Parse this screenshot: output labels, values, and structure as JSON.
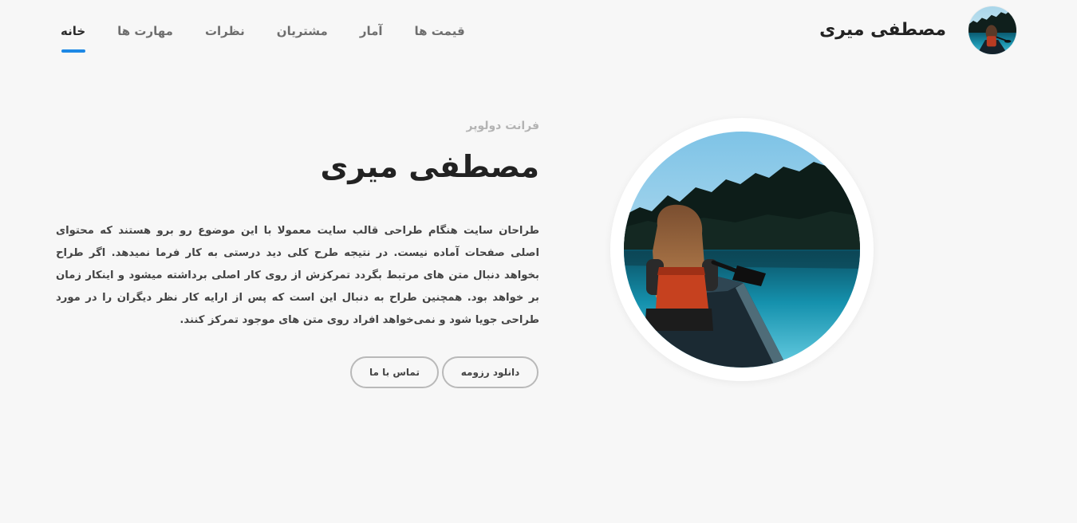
{
  "header": {
    "brand_name": "مصطفی میری",
    "avatar_icon": "person-in-canoe-photo"
  },
  "nav": {
    "items": [
      {
        "label": "خانه",
        "active": true
      },
      {
        "label": "مهارت ها",
        "active": false
      },
      {
        "label": "نظرات",
        "active": false
      },
      {
        "label": "مشتریان",
        "active": false
      },
      {
        "label": "آمار",
        "active": false
      },
      {
        "label": "قیمت ها",
        "active": false
      }
    ]
  },
  "hero": {
    "subtitle": "فرانت دولوپر",
    "title": "مصطفی میری",
    "description": "طراحان سایت هنگام طراحی قالب سایت معمولا با این موضوع رو برو هستند که محتوای اصلی صفحات آماده نیست. در نتیجه طرح کلی دید درستی به کار فرما نمیدهد. اگر طراح بخواهد دنبال متن های مرتبط بگردد تمرکزش از روی کار اصلی برداشته میشود و اینکار زمان بر خواهد بود. همچنین طراح به دنبال این است که پس از ارایه کار نظر دیگران را در مورد طراحی جویا شود و نمی‌خواهد افراد روی متن های موجود تمرکز کنند.",
    "buttons": {
      "resume": "دانلود رزومه",
      "contact": "تماس با ما"
    },
    "image_icon": "person-in-canoe-photo"
  },
  "colors": {
    "accent": "#1e88e5",
    "background": "#f7f7f7",
    "text": "#222222",
    "muted": "#b3b3b3"
  }
}
